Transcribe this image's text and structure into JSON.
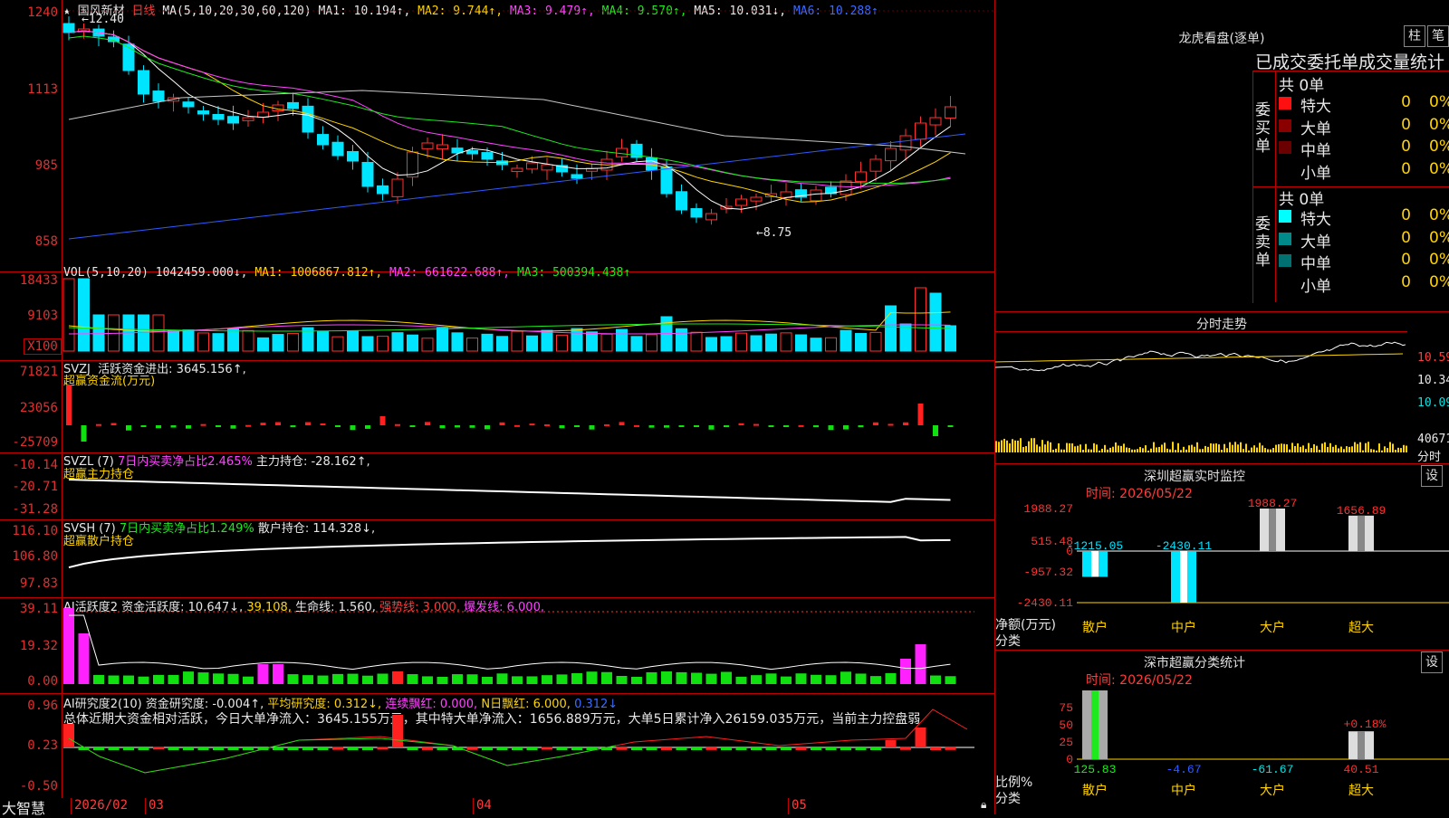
{
  "app": {
    "name": "大智慧"
  },
  "main_chart": {
    "star": "★",
    "stock_name": "国风新材",
    "period": "日线",
    "ma_label": "MA(5,10,20,30,60,120)",
    "ma1": "MA1: 10.194↑,",
    "ma2": "MA2: 9.744↑,",
    "ma3": "MA3: 9.479↑,",
    "ma4": "MA4: 9.570↑,",
    "ma5": "MA5: 10.031↓,",
    "ma6": "MA6: 10.288↑",
    "high_mark": "12.40",
    "low_mark": "8.75",
    "y_ticks": [
      "1240",
      "1113",
      "985",
      "858"
    ]
  },
  "vol_pane": {
    "label": "VOL(5,10,20)",
    "value": "1042459.000↓,",
    "ma1": "MA1: 1006867.812↑,",
    "ma2": "MA2: 661622.688↑,",
    "ma3": "MA3: 500394.438↑",
    "y_ticks": [
      "18433",
      "9103"
    ],
    "unit": "X100"
  },
  "svzj_pane": {
    "label": "SVZJ",
    "title": "活跃资金进出: 3645.156↑,",
    "subtitle": "超赢资金流(万元)",
    "y_ticks": [
      "71821",
      "23056",
      "-25709"
    ]
  },
  "svzl_pane": {
    "label": "SVZL (7)",
    "ratio": "7日内买卖净占比2.465%",
    "hold": "主力持仓: -28.162↑,",
    "subtitle": "超赢主力持仓",
    "y_ticks": [
      "-10.14",
      "-20.71",
      "-31.28"
    ]
  },
  "svsh_pane": {
    "label": "SVSH (7)",
    "ratio": "7日内买卖净占比1.249%",
    "hold": "散户持仓: 114.328↓,",
    "subtitle": "超赢散户持仓",
    "y_ticks": [
      "116.10",
      "106.80",
      "97.83"
    ]
  },
  "ai_active_pane": {
    "label": "AI活跃度2",
    "v1": "资金活跃度: 10.647↓,",
    "v2": "39.108,",
    "v3": "生命线: 1.560,",
    "v4": "强势线: 3.000,",
    "v5": "爆发线: 6.000,",
    "y_ticks": [
      "39.11",
      "19.32",
      "0.00"
    ]
  },
  "ai_research_pane": {
    "label": "AI研究度2(10)",
    "v1": "资金研究度: -0.004↑,",
    "v2": "平均研究度: 0.312↓,",
    "v3": "连续飘红: 0.000,",
    "v4": "N日飘红: 6.000,",
    "v5": "0.312↓",
    "summary": "总体近期大资金相对活跃，今日大单净流入：3645.155万元，其中特大单净流入：1656.889万元，大单5日累计净入26159.035万元，当前主力控盘弱",
    "y_ticks": [
      "0.96",
      "0.23",
      "-0.50"
    ]
  },
  "x_axis": {
    "labels": [
      "2026/02",
      "03",
      "04",
      "05"
    ]
  },
  "dragon_panel": {
    "title": "龙虎看盘(逐单)",
    "btn_zhu": "柱",
    "btn_bi": "笔",
    "header": "已成交委托单成交量统计",
    "buy_group": {
      "total": "共 0单",
      "side_label": "委买单",
      "rows": [
        {
          "name": "特大",
          "count": "0",
          "pct": "0%",
          "color": "#ff1010"
        },
        {
          "name": "大单",
          "count": "0",
          "pct": "0%",
          "color": "#8a0000"
        },
        {
          "name": "中单",
          "count": "0",
          "pct": "0%",
          "color": "#6a0000"
        },
        {
          "name": "小单",
          "count": "0",
          "pct": "0%",
          "color": "#000000"
        }
      ]
    },
    "sell_group": {
      "total": "共 0单",
      "side_label": "委卖单",
      "rows": [
        {
          "name": "特大",
          "count": "0",
          "pct": "0%",
          "color": "#00ffff"
        },
        {
          "name": "大单",
          "count": "0",
          "pct": "0%",
          "color": "#008a8a"
        },
        {
          "name": "中单",
          "count": "0",
          "pct": "0%",
          "color": "#007070"
        },
        {
          "name": "小单",
          "count": "0",
          "pct": "0%",
          "color": "#000000"
        }
      ]
    }
  },
  "intraday_panel": {
    "title": "分时走势",
    "price_ticks": [
      "10.59",
      "10.34",
      "10.09"
    ],
    "vol_tick": "40671",
    "vol_unit": "分时"
  },
  "sz_monitor": {
    "title": "深圳超赢实时监控",
    "settings": "设",
    "time": "时间: 2026/05/22",
    "y_ticks": [
      "1988.27",
      "515.48",
      "0",
      "-957.32",
      "-2430.11"
    ],
    "ylabel": "净额(万元)",
    "xlabel": "分类",
    "bars": [
      {
        "label": "散户",
        "value": -1215.05,
        "text": "-1215.05"
      },
      {
        "label": "中户",
        "value": -2430.11,
        "text": "-2430.11"
      },
      {
        "label": "大户",
        "value": 1988.27,
        "text": "1988.27"
      },
      {
        "label": "超大",
        "value": 1656.89,
        "text": "1656.89"
      }
    ]
  },
  "sz_class": {
    "title": "深市超赢分类统计",
    "settings": "设",
    "time": "时间: 2026/05/22",
    "y_ticks": [
      "75",
      "50",
      "25",
      "0"
    ],
    "ylabel": "比例%",
    "xlabel": "分类",
    "bars": [
      {
        "label": "散户",
        "value": 125.83,
        "text": "125.83"
      },
      {
        "label": "中户",
        "value": -4.67,
        "text": "-4.67"
      },
      {
        "label": "大户",
        "value": -61.67,
        "text": "-61.67"
      },
      {
        "label": "超大",
        "value": 40.51,
        "text": "40.51"
      }
    ],
    "extra_label": "+0.18%"
  }
}
